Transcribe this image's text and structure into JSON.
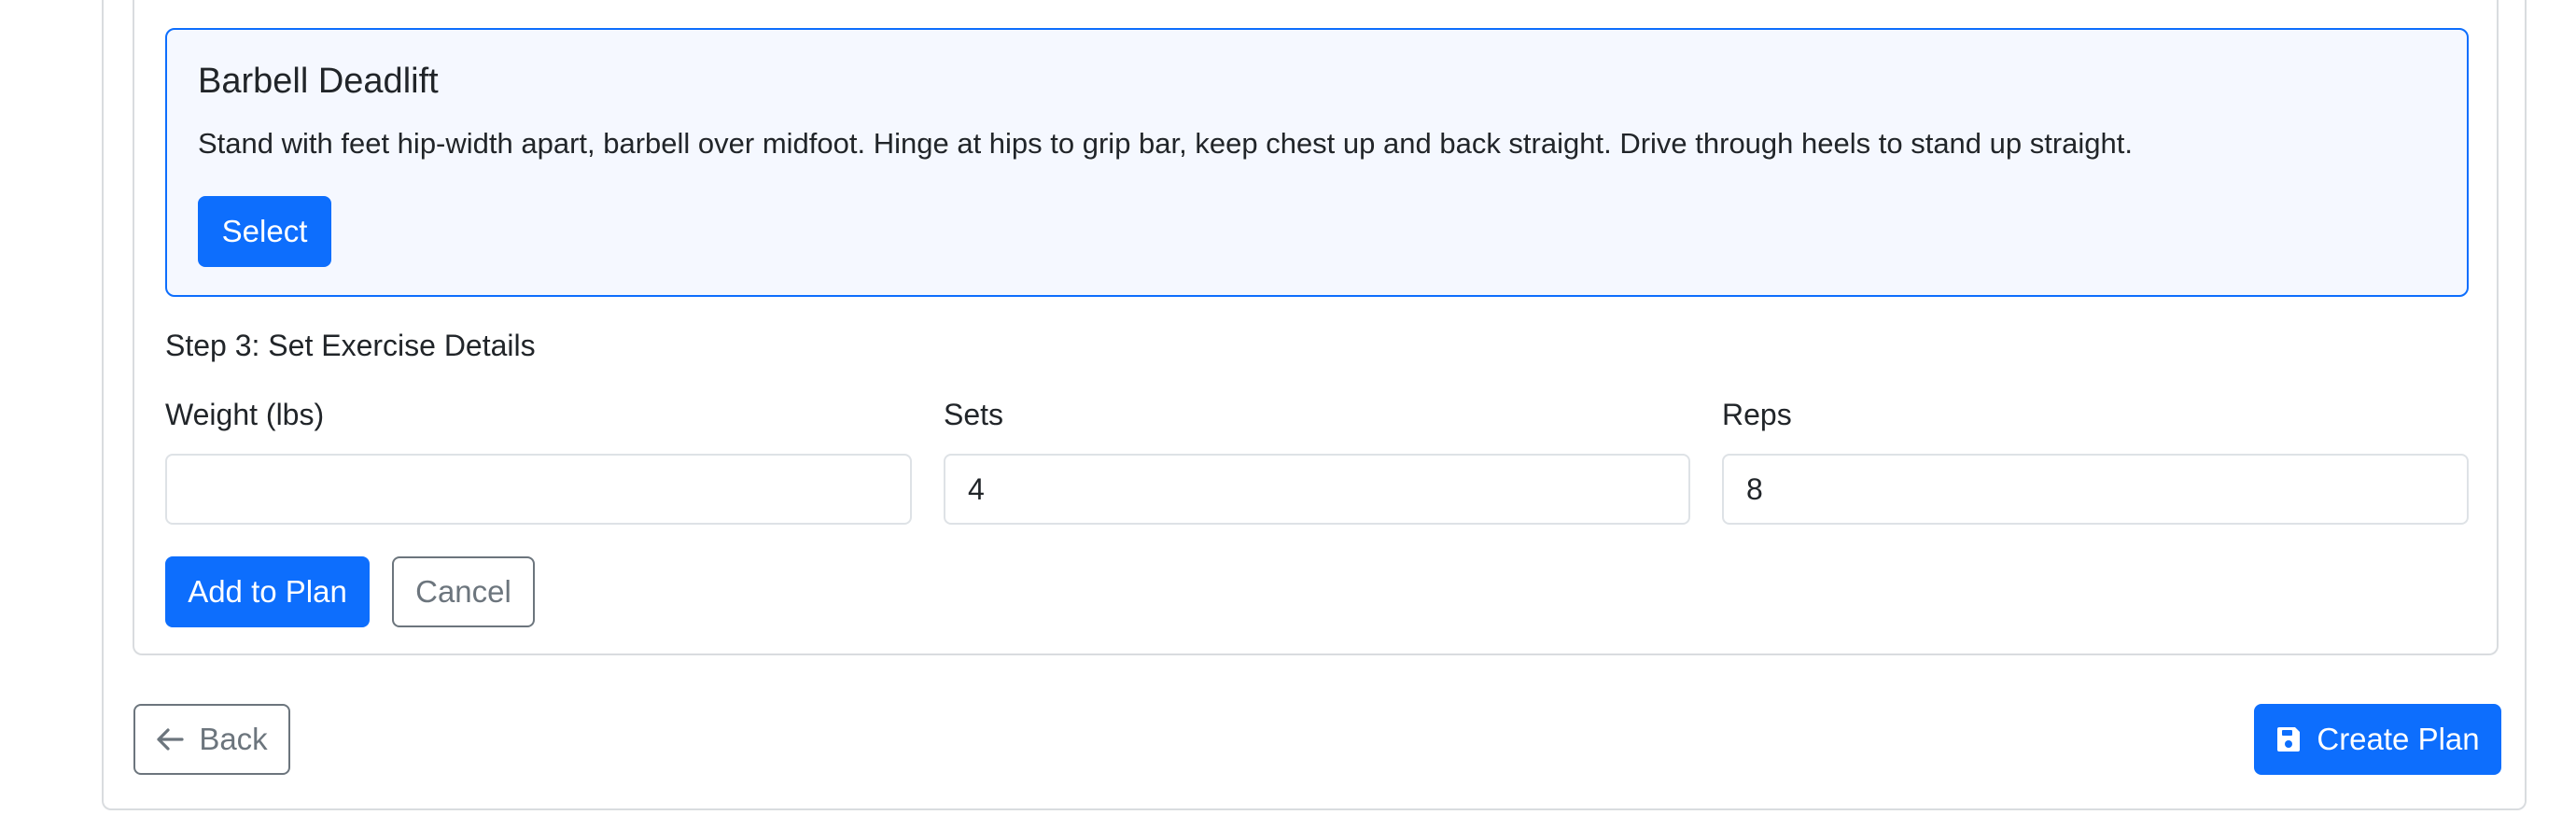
{
  "exercise": {
    "title": "Barbell Deadlift",
    "description": "Stand with feet hip-width apart, barbell over midfoot. Hinge at hips to grip bar, keep chest up and back straight. Drive through heels to stand up straight.",
    "select_label": "Select"
  },
  "step3": {
    "title": "Step 3: Set Exercise Details",
    "weight": {
      "label": "Weight (lbs)",
      "value": "",
      "placeholder": ""
    },
    "sets": {
      "label": "Sets",
      "value": "4"
    },
    "reps": {
      "label": "Reps",
      "value": "8"
    },
    "add_label": "Add to Plan",
    "cancel_label": "Cancel"
  },
  "footer": {
    "back_label": "Back",
    "back_icon": "arrow-left-icon",
    "create_label": "Create Plan",
    "create_icon": "save-icon"
  },
  "colors": {
    "primary": "#0d6efd",
    "secondary": "#6c757d",
    "selected_card_bg": "#f5f8ff"
  }
}
